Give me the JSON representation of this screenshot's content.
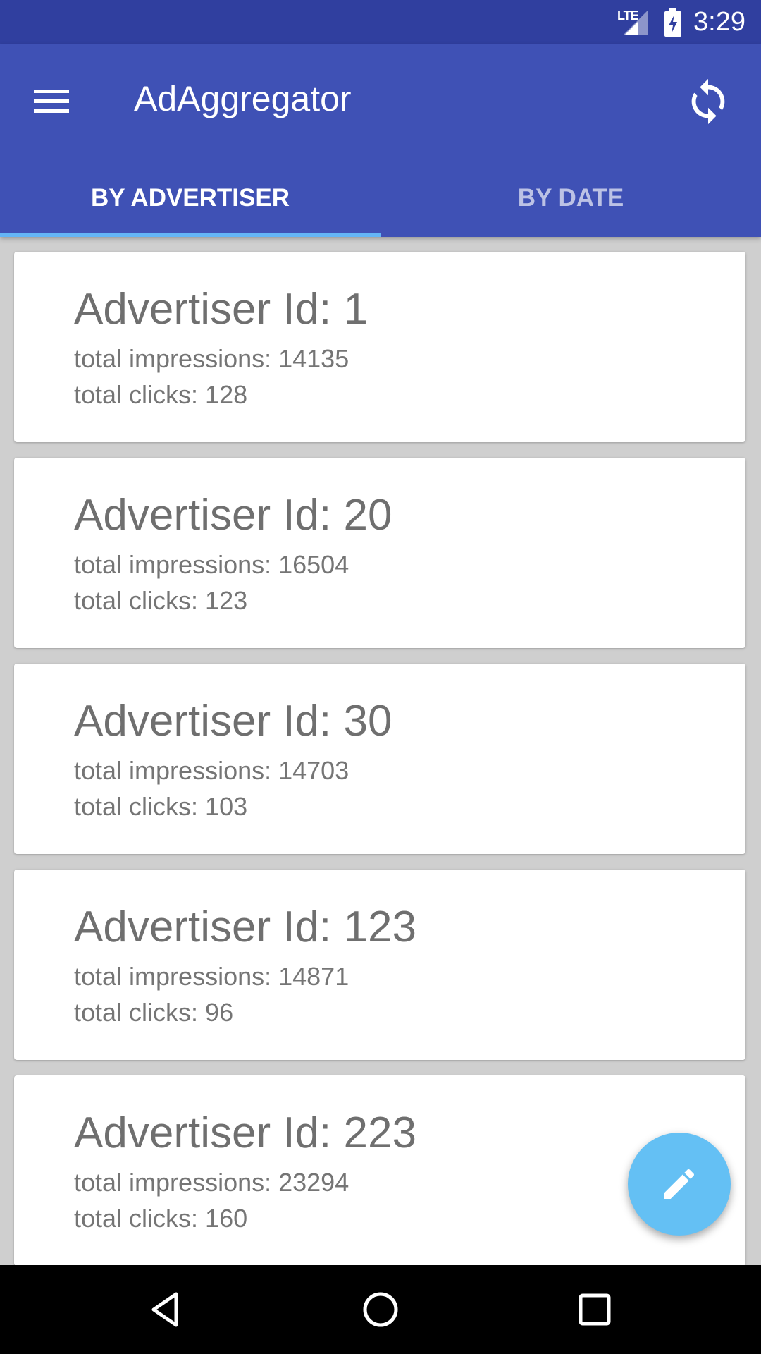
{
  "status_bar": {
    "network_label": "LTE",
    "time": "3:29"
  },
  "app_bar": {
    "title": "AdAggregator",
    "menu_icon": "hamburger-menu-icon",
    "refresh_icon": "sync-icon"
  },
  "tabs": [
    {
      "label": "BY ADVERTISER",
      "active": true
    },
    {
      "label": "BY DATE",
      "active": false
    }
  ],
  "advertisers": [
    {
      "title": "Advertiser Id: 1",
      "impressions": "total impressions: 14135",
      "clicks": "total clicks: 128"
    },
    {
      "title": "Advertiser Id: 20",
      "impressions": "total impressions: 16504",
      "clicks": "total clicks: 123"
    },
    {
      "title": "Advertiser Id: 30",
      "impressions": "total impressions: 14703",
      "clicks": "total clicks: 103"
    },
    {
      "title": "Advertiser Id: 123",
      "impressions": "total impressions: 14871",
      "clicks": "total clicks: 96"
    },
    {
      "title": "Advertiser Id: 223",
      "impressions": "total impressions: 23294",
      "clicks": "total clicks: 160"
    }
  ],
  "fab": {
    "icon": "pencil-icon"
  },
  "colors": {
    "status_bar": "#303f9f",
    "primary": "#3f51b5",
    "tab_indicator": "#64b5f6",
    "fab": "#64c0f4",
    "background": "#cfcfcf"
  }
}
